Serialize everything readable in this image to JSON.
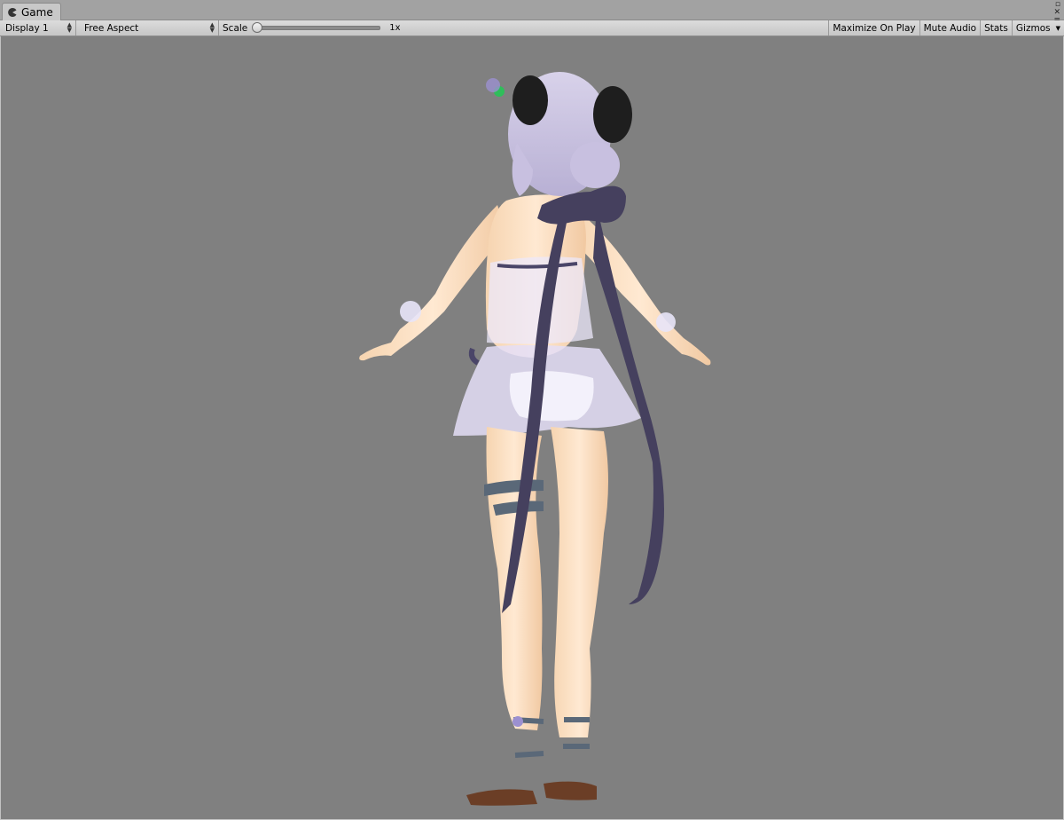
{
  "window": {
    "tab_label": "Game",
    "tab_icon": "pacman-game-icon",
    "controls": [
      "restore-icon",
      "close-icon",
      "menu-icon"
    ]
  },
  "toolbar": {
    "display_label": "Display 1",
    "aspect_label": "Free Aspect",
    "scale_label": "Scale",
    "scale_value": "1x",
    "scale_level": 0.0,
    "maximize_label": "Maximize On Play",
    "mute_label": "Mute Audio",
    "stats_label": "Stats",
    "gizmos_label": "Gizmos"
  },
  "viewport": {
    "background": "#808080",
    "content": "3d-character-back-view"
  }
}
